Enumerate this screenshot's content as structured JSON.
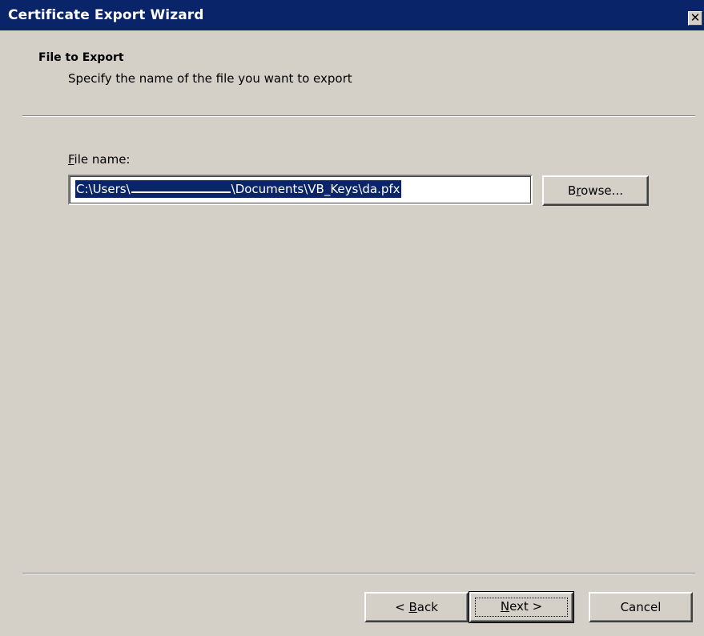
{
  "window": {
    "title": "Certificate Export Wizard",
    "close_glyph": "✕"
  },
  "header": {
    "title": "File to Export",
    "subtitle": "Specify the name of the file you want to export"
  },
  "file_name": {
    "label_accel": "F",
    "label_rest": "ile name:",
    "value_prefix": "C:\\Users\\",
    "value_suffix": "\\Documents\\VB_Keys\\da.pfx"
  },
  "buttons": {
    "browse_pre": "B",
    "browse_accel": "r",
    "browse_post": "owse...",
    "back_pre": "< ",
    "back_accel": "B",
    "back_post": "ack",
    "next_accel": "N",
    "next_post": "ext >",
    "cancel": "Cancel"
  },
  "colors": {
    "face": "#d4d0c8",
    "titlebar": "#0a246a",
    "selection": "#0a246a"
  }
}
